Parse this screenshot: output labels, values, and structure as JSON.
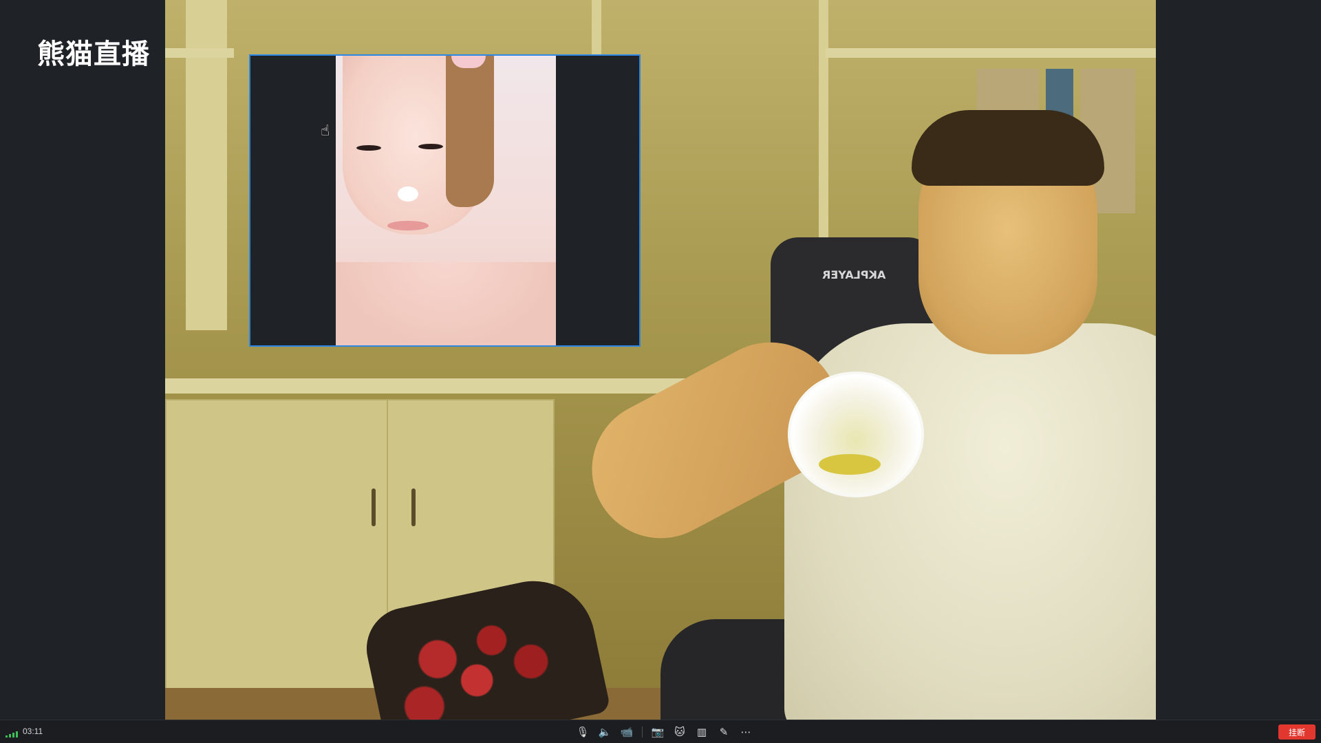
{
  "app": {
    "logo_text": "熊猫直播"
  },
  "main_video": {
    "chair_label": "AKPLAYER"
  },
  "status_bar": {
    "call_time": "03:11",
    "hangup_label": "挂断",
    "controls": [
      {
        "name": "microphone-icon",
        "glyph": "🎙"
      },
      {
        "name": "speaker-icon",
        "glyph": "🔈"
      },
      {
        "name": "camera-icon",
        "glyph": "📹"
      },
      {
        "name": "screenshot-icon",
        "glyph": "📷"
      },
      {
        "name": "beauty-filter-icon",
        "glyph": "🐱"
      },
      {
        "name": "layout-icon",
        "glyph": "▥"
      },
      {
        "name": "edit-icon",
        "glyph": "✎"
      },
      {
        "name": "more-icon",
        "glyph": "⋯"
      }
    ]
  },
  "colors": {
    "background": "#1f2226",
    "pip_border": "#2c86e6",
    "hangup": "#e2372f",
    "signal": "#3fbf5a"
  }
}
